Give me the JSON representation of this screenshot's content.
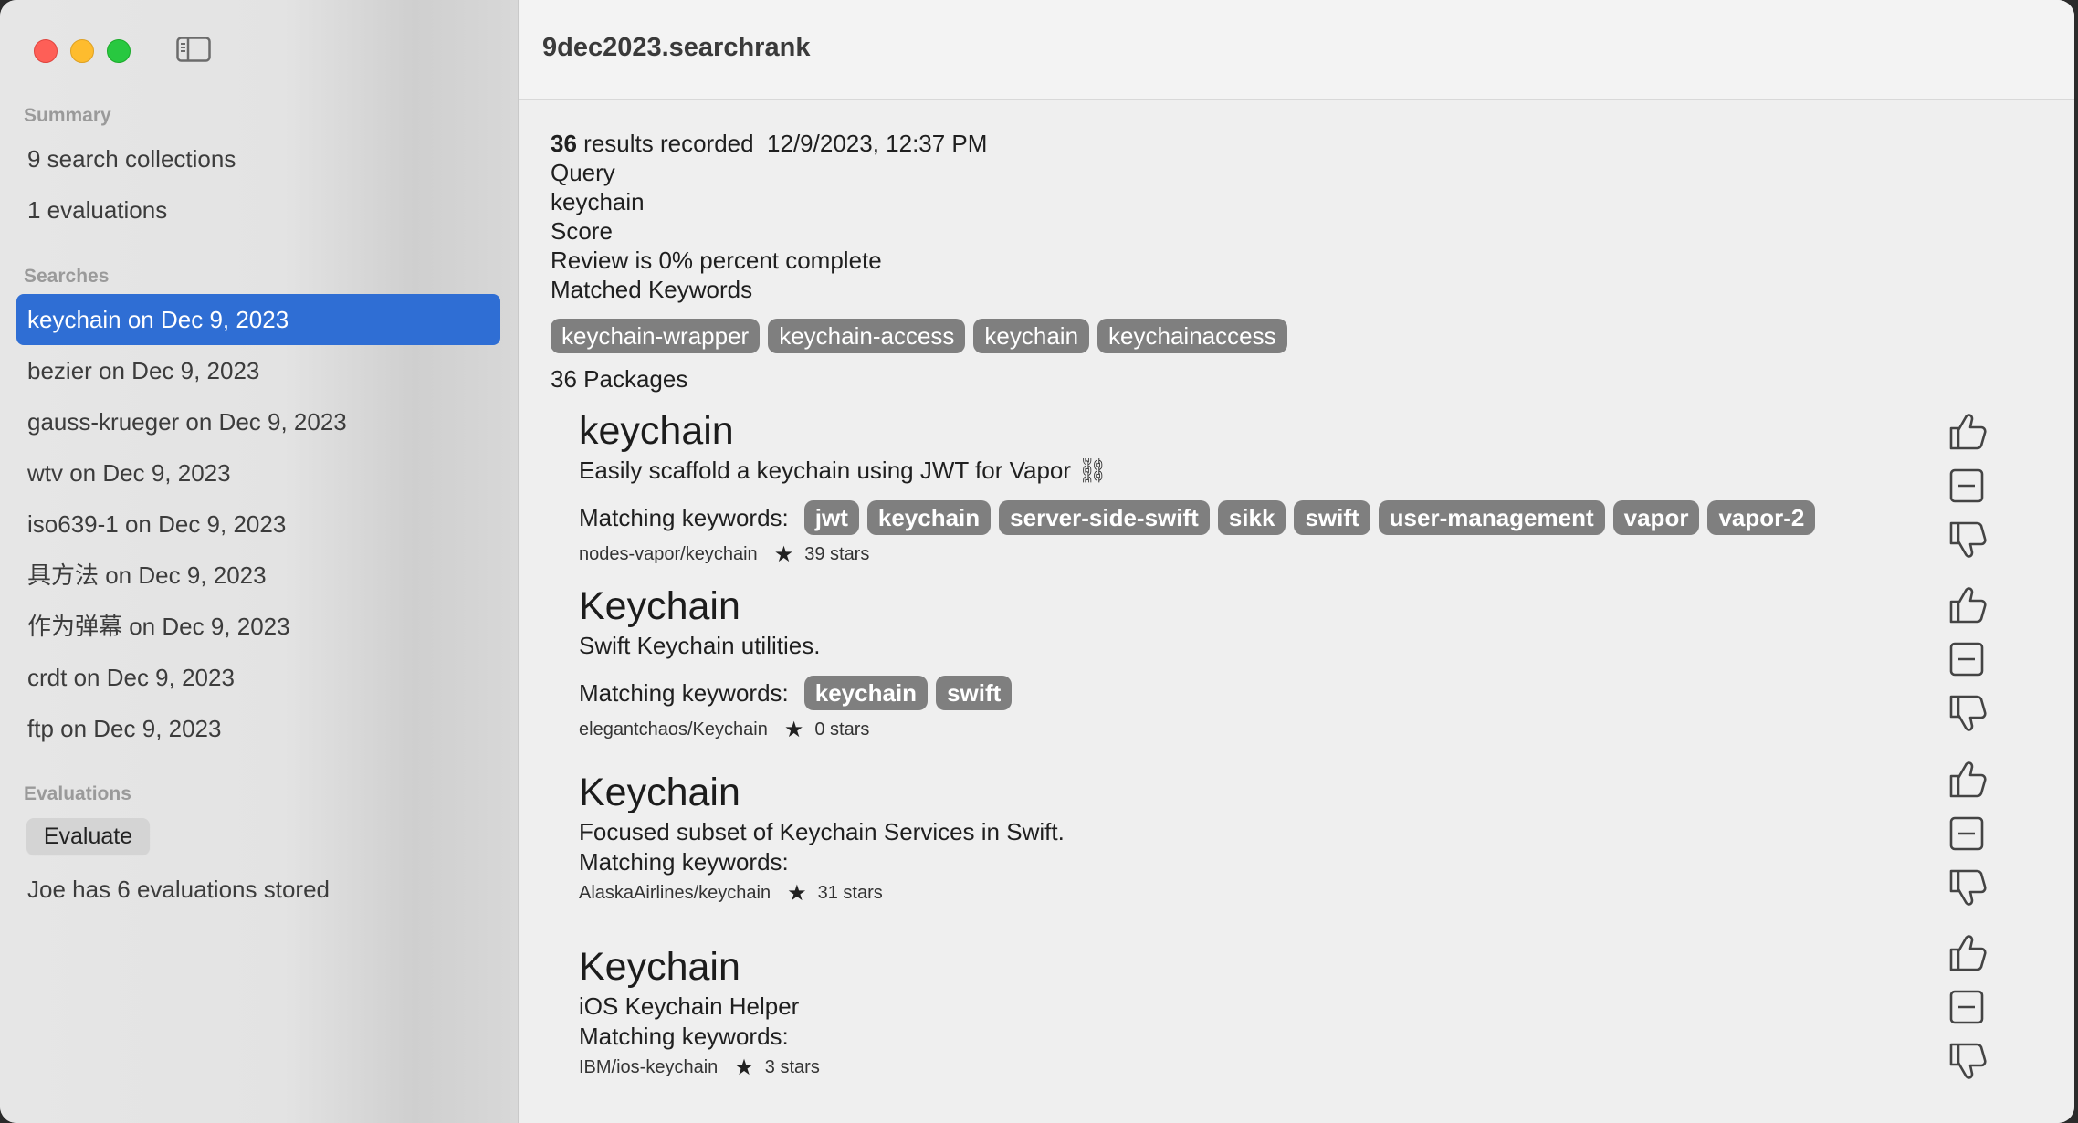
{
  "window": {
    "title": "9dec2023.searchrank"
  },
  "sidebar": {
    "summary_header": "Summary",
    "summary_items": [
      "9 search collections",
      "1 evaluations"
    ],
    "searches_header": "Searches",
    "searches": [
      "keychain on Dec 9, 2023",
      "bezier on Dec 9, 2023",
      "gauss-krueger on Dec 9, 2023",
      "wtv on Dec 9, 2023",
      "iso639-1 on Dec 9, 2023",
      "具方法 on Dec 9, 2023",
      "作为弹幕 on Dec 9, 2023",
      "crdt on Dec 9, 2023",
      "ftp on Dec 9, 2023"
    ],
    "selected_index": 0,
    "evaluations_header": "Evaluations",
    "evaluate_button": "Evaluate",
    "evaluations_note": "Joe has 6 evaluations stored"
  },
  "summary": {
    "count": "36",
    "results_text": "results recorded",
    "recorded_at": "12/9/2023, 12:37 PM",
    "query_label": "Query",
    "query_value": "keychain",
    "score_label": "Score",
    "review_text": "Review is 0% percent complete",
    "matched_label": "Matched Keywords",
    "matched_keywords": [
      "keychain-wrapper",
      "keychain-access",
      "keychain",
      "keychainaccess"
    ],
    "packages_count": "36 Packages"
  },
  "packages": [
    {
      "name": "keychain",
      "description": "Easily scaffold a keychain using JWT for Vapor ⛓",
      "keywords_label": "Matching keywords:",
      "keywords": [
        "jwt",
        "keychain",
        "server-side-swift",
        "sikk",
        "swift",
        "user-management",
        "vapor",
        "vapor-2"
      ],
      "repo": "nodes-vapor/keychain",
      "stars": "39 stars"
    },
    {
      "name": "Keychain",
      "description": "Swift Keychain utilities.",
      "keywords_label": "Matching keywords:",
      "keywords": [
        "keychain",
        "swift"
      ],
      "repo": "elegantchaos/Keychain",
      "stars": "0 stars"
    },
    {
      "name": "Keychain",
      "description": "Focused subset of Keychain Services in Swift.",
      "keywords_label": "Matching keywords:",
      "keywords": [],
      "repo": "AlaskaAirlines/keychain",
      "stars": "31 stars"
    },
    {
      "name": "Keychain",
      "description": "iOS Keychain Helper",
      "keywords_label": "Matching keywords:",
      "keywords": [],
      "repo": "IBM/ios-keychain",
      "stars": "3 stars"
    }
  ],
  "icons": {
    "thumbs_up": "thumbs-up-icon",
    "neutral": "minus-square-icon",
    "thumbs_down": "thumbs-down-icon",
    "star": "star-icon",
    "sidebar_toggle": "sidebar-toggle-icon"
  },
  "colors": {
    "selection": "#2f6ed4",
    "chip": "#7f7f7f",
    "close": "#fe5f57",
    "minimize": "#febc2e",
    "zoom": "#28c840"
  }
}
